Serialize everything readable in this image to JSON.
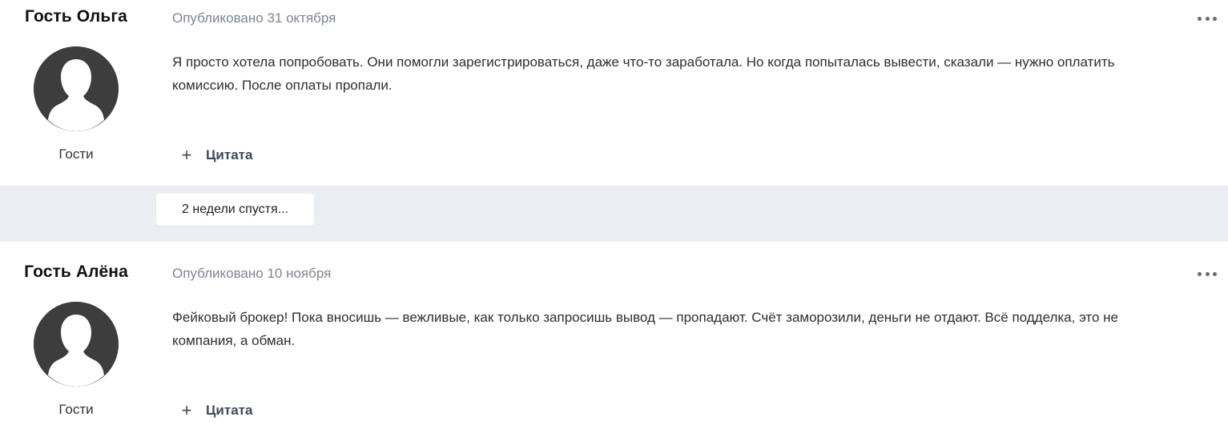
{
  "posts": [
    {
      "author": "Гость Ольга",
      "group": "Гости",
      "published": "Опубликовано 31 октября",
      "text_line1": "Я просто хотела попробовать. Они помогли зарегистрироваться, даже что-то заработала. Но когда попыталась вывести, сказали — нужно оплатить",
      "text_line2": "комиссию. После оплаты пропали.",
      "quote_label": "Цитата",
      "avatar_icon": "user-silhouette-icon",
      "more_icon": "ellipsis-icon"
    },
    {
      "author": "Гость Алёна",
      "group": "Гости",
      "published": "Опубликовано 10 ноября",
      "text_line1": "Фейковый брокер! Пока вносишь — вежливые, как только запросишь вывод — пропадают. Счёт заморозили, деньги не отдают. Всё подделка, это не",
      "text_line2": "компания, а обман.",
      "quote_label": "Цитата",
      "avatar_icon": "user-silhouette-icon",
      "more_icon": "ellipsis-icon"
    }
  ],
  "separator": {
    "label": "2 недели спустя..."
  },
  "colors": {
    "separator_bg": "#ebeef2",
    "meta_text": "#7d8594",
    "avatar_bg": "#3d3d3d",
    "quote_text": "#3d4a5c"
  }
}
